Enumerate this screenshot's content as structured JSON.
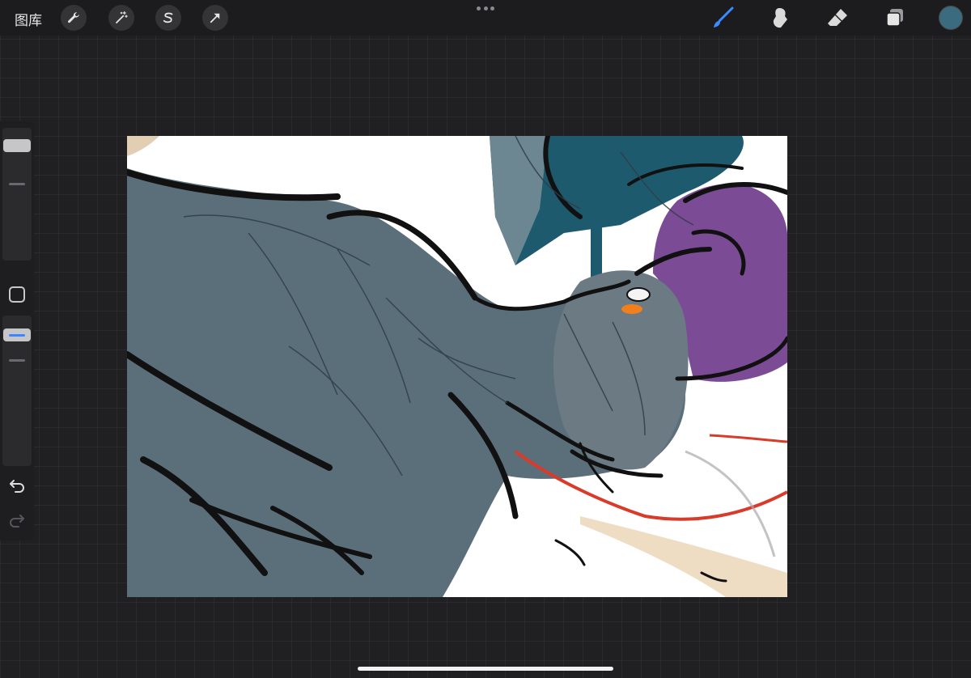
{
  "topbar": {
    "gallery_label": "图库",
    "left_tools": [
      "wrench-icon",
      "magic-wand-icon",
      "selection-icon",
      "transform-arrow-icon"
    ],
    "right_tools": [
      "brush-icon",
      "smudge-icon",
      "eraser-icon",
      "layers-icon"
    ],
    "active_tool": "brush",
    "current_color": "#3b6b7e"
  },
  "sidebar": {
    "tools": [
      "brush-size-slider",
      "modify-button",
      "opacity-slider",
      "undo-icon",
      "redo-icon"
    ]
  },
  "canvas": {
    "background": "#ffffff",
    "palette": {
      "skin": "#5a6f7c",
      "hat": "#1d5a6e",
      "hair": "#7a4a94",
      "lines": "#111111",
      "accent_orange": "#f07f1c",
      "accent_red": "#d93b2b",
      "accent_tan": "#e8cfb0"
    }
  }
}
